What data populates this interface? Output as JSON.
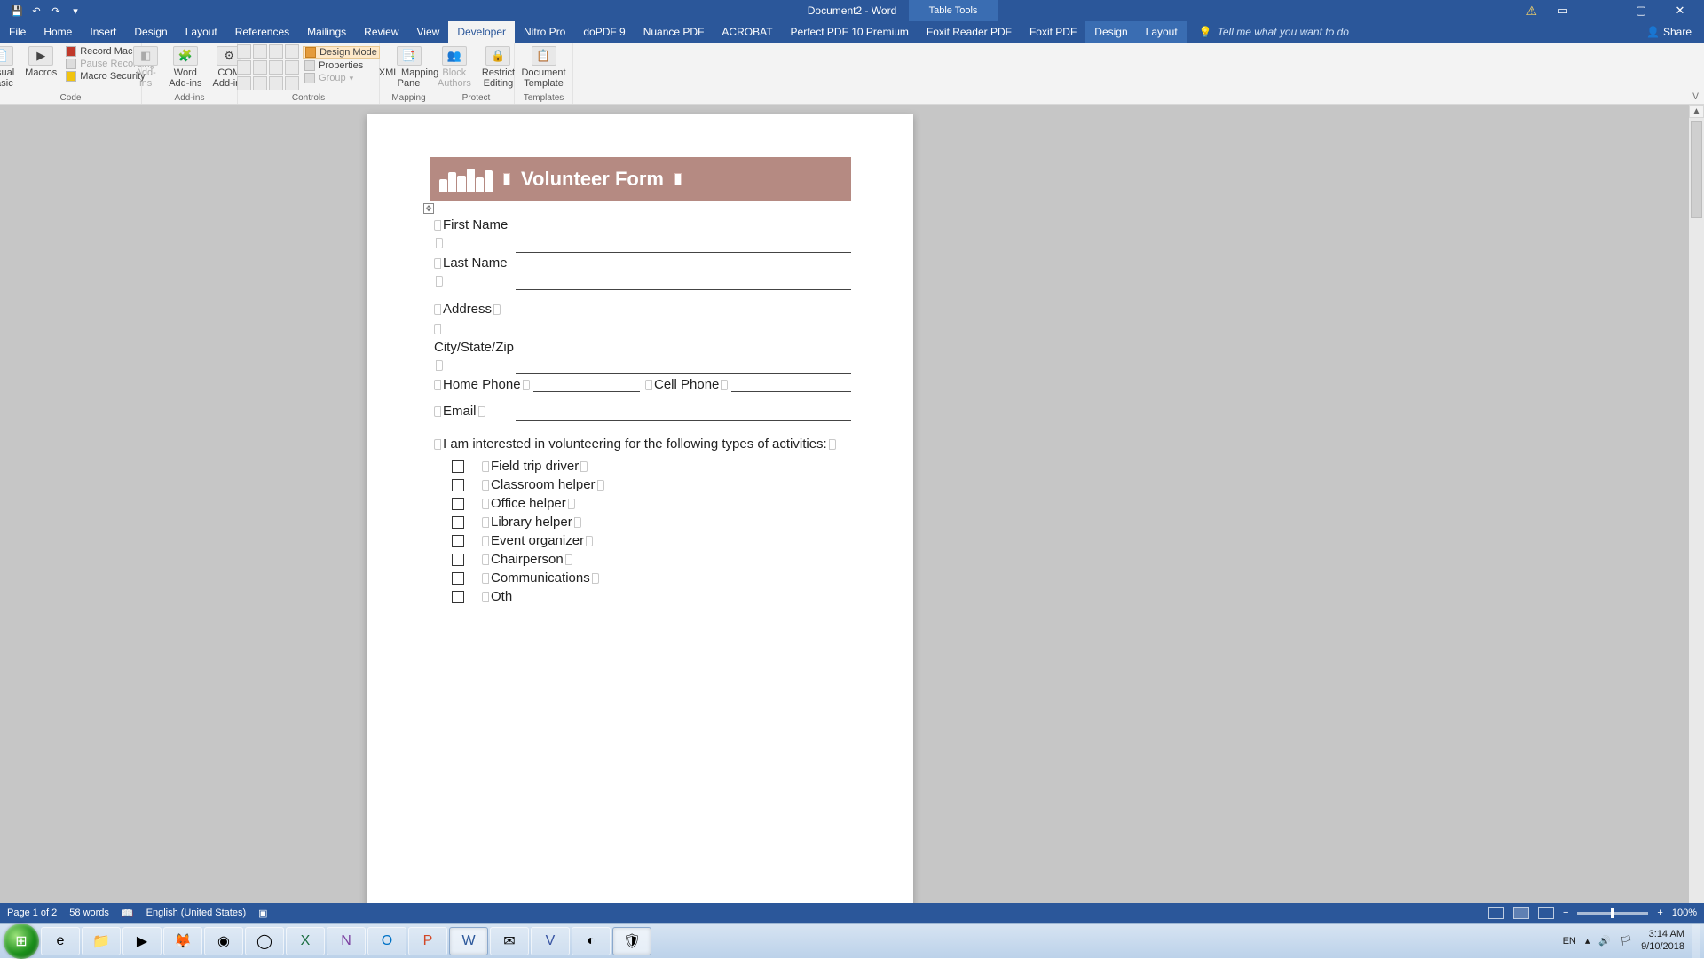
{
  "titlebar": {
    "doc_title": "Document2 - Word",
    "table_tools": "Table Tools"
  },
  "tabs": {
    "file": "File",
    "home": "Home",
    "insert": "Insert",
    "design": "Design",
    "layout": "Layout",
    "references": "References",
    "mailings": "Mailings",
    "review": "Review",
    "view": "View",
    "developer": "Developer",
    "nitro": "Nitro Pro",
    "dopdf": "doPDF 9",
    "nuance": "Nuance PDF",
    "acrobat": "ACROBAT",
    "perfectpdf": "Perfect PDF 10 Premium",
    "foxit": "Foxit Reader PDF",
    "foxitpdf": "Foxit PDF",
    "tt_design": "Design",
    "tt_layout": "Layout",
    "tellme": "Tell me what you want to do",
    "share": "Share"
  },
  "ribbon": {
    "code": {
      "label": "Code",
      "visual_basic": "Visual\nBasic",
      "macros": "Macros",
      "record_macro": "Record Macro",
      "pause_recording": "Pause Recording",
      "macro_security": "Macro Security"
    },
    "addins": {
      "label": "Add-ins",
      "addins_btn": "Add-\nins",
      "word_addins": "Word\nAdd-ins",
      "com_addins": "COM\nAdd-ins"
    },
    "controls": {
      "label": "Controls",
      "design_mode": "Design Mode",
      "properties": "Properties",
      "group": "Group"
    },
    "mapping": {
      "label": "Mapping",
      "xml_pane": "XML Mapping\nPane"
    },
    "protect": {
      "label": "Protect",
      "block_authors": "Block\nAuthors",
      "restrict_editing": "Restrict\nEditing"
    },
    "templates": {
      "label": "Templates",
      "doc_template": "Document\nTemplate"
    }
  },
  "form": {
    "title": "Volunteer Form",
    "first_name": "First Name",
    "last_name": "Last Name",
    "address": "Address",
    "city_state_zip": "City/State/Zip",
    "home_phone": "Home Phone",
    "cell_phone": "Cell Phone",
    "email": "Email",
    "interest": "I am interested in volunteering for the following types of activities:",
    "activities": {
      "a0": "Field trip driver",
      "a1": "Classroom helper",
      "a2": "Office helper",
      "a3": "Library helper",
      "a4": "Event organizer",
      "a5": "Chairperson",
      "a6": "Communications",
      "a7": "Oth"
    }
  },
  "status": {
    "page": "Page 1 of 2",
    "words": "58 words",
    "language": "English (United States)",
    "zoom": "100%"
  },
  "tray": {
    "lang": "EN",
    "time": "3:14 AM",
    "date": "9/10/2018"
  }
}
